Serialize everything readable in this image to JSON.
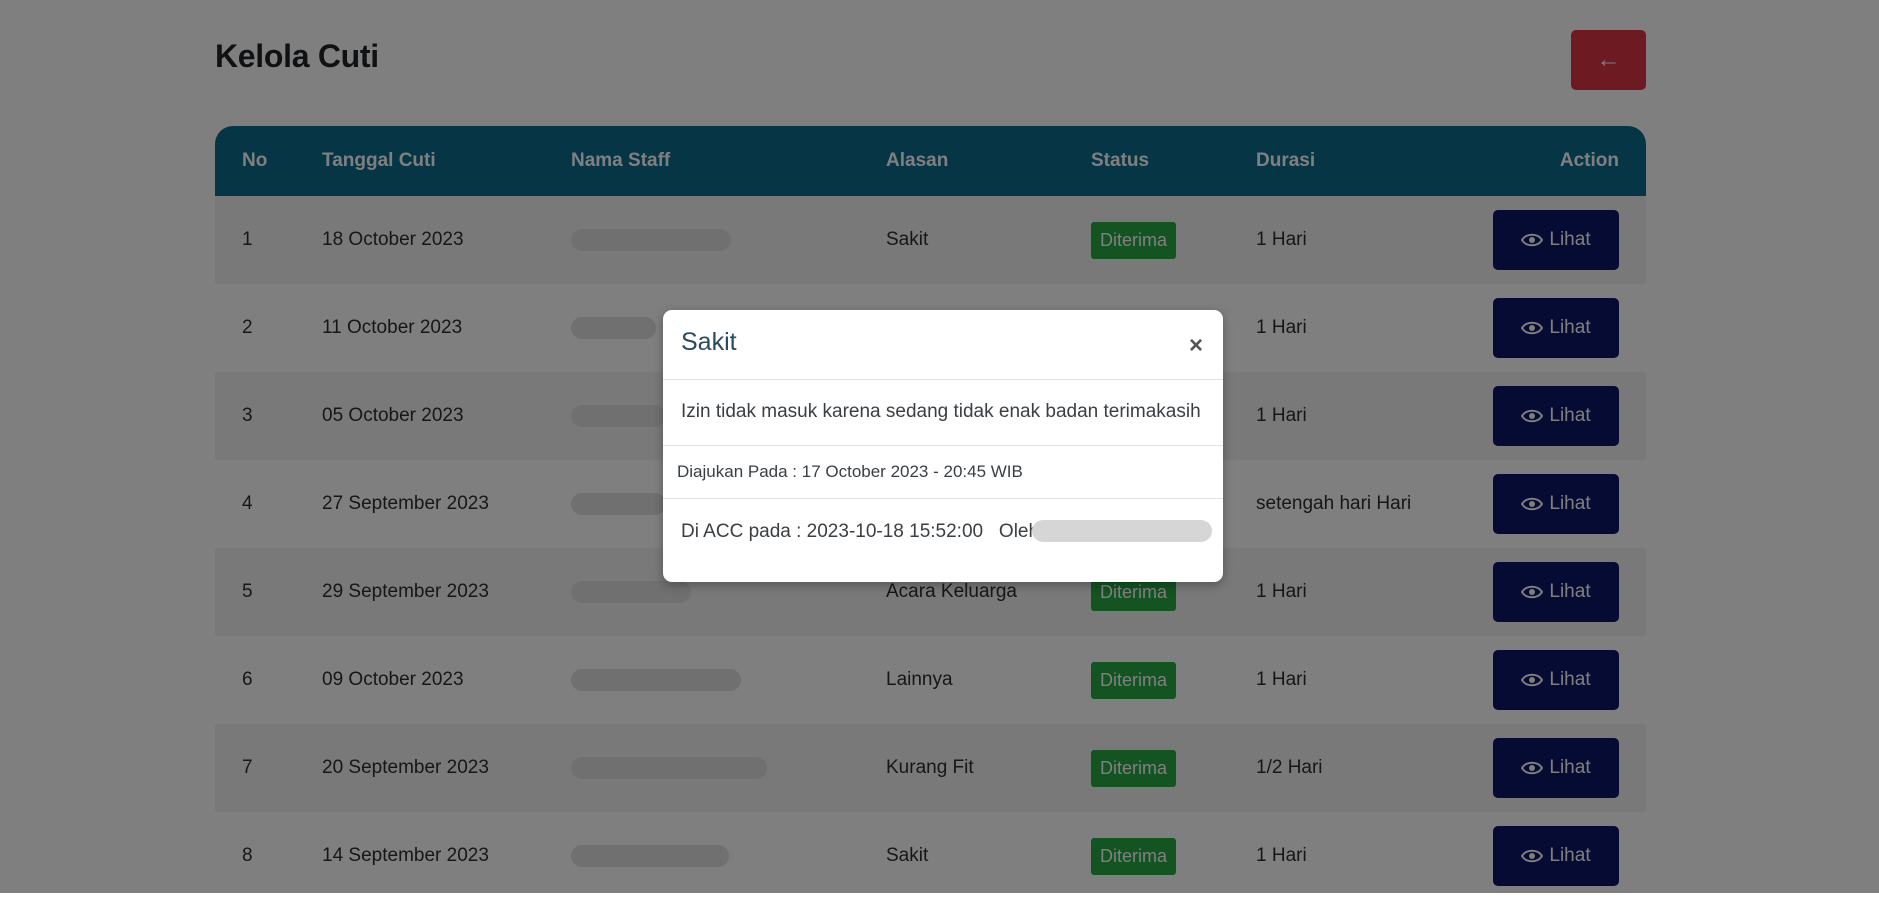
{
  "page": {
    "title": "Kelola Cuti",
    "back_label": "←"
  },
  "table": {
    "headers": [
      "No",
      "Tanggal Cuti",
      "Nama Staff",
      "Alasan",
      "Status",
      "Durasi",
      "Action"
    ],
    "rows": [
      {
        "no": "1",
        "date": "18 October 2023",
        "reason": "Sakit",
        "status": "Diterima",
        "duration": "1 Hari",
        "action": "Lihat"
      },
      {
        "no": "2",
        "date": "11 October 2023",
        "reason": "",
        "status": "",
        "duration": "1 Hari",
        "action": "Lihat"
      },
      {
        "no": "3",
        "date": "05 October 2023",
        "reason": "",
        "status": "",
        "duration": "1 Hari",
        "action": "Lihat"
      },
      {
        "no": "4",
        "date": "27 September 2023",
        "reason": "",
        "status": "",
        "duration": "setengah hari Hari",
        "action": "Lihat"
      },
      {
        "no": "5",
        "date": "29 September 2023",
        "reason": "Acara Keluarga",
        "status": "Diterima",
        "duration": "1 Hari",
        "action": "Lihat"
      },
      {
        "no": "6",
        "date": "09 October 2023",
        "reason": "Lainnya",
        "status": "Diterima",
        "duration": "1 Hari",
        "action": "Lihat"
      },
      {
        "no": "7",
        "date": "20 September 2023",
        "reason": "Kurang Fit",
        "status": "Diterima",
        "duration": "1/2 Hari",
        "action": "Lihat"
      },
      {
        "no": "8",
        "date": "14 September 2023",
        "reason": "Sakit",
        "status": "Diterima",
        "duration": "1 Hari",
        "action": "Lihat"
      }
    ]
  },
  "modal": {
    "title": "Sakit",
    "close": "×",
    "body": "Izin tidak masuk karena sedang tidak enak badan terimakasih",
    "submitted": "Diajukan Pada : 17 October 2023 - 20:45 WIB",
    "acc": "Di ACC pada : 2023-10-18 15:52:00   Oleh :"
  },
  "colors": {
    "header_bg": "#0c6c8d",
    "badge_bg": "#28a745",
    "action_bg": "#0a1664",
    "back_bg": "#dc3545"
  },
  "icons": {
    "back": "arrow-left-icon",
    "action": "eye-icon",
    "close": "close-icon"
  }
}
